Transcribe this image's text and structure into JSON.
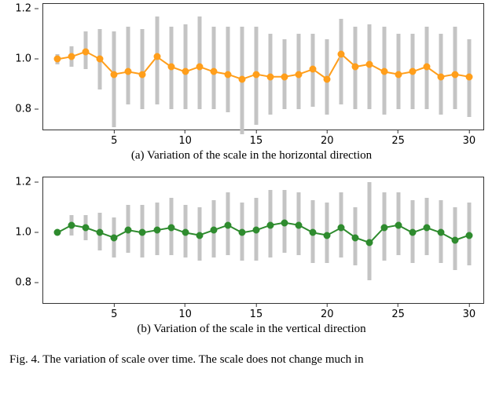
{
  "chart_data": [
    {
      "type": "line",
      "color": "#ff9e1b",
      "x": [
        1,
        2,
        3,
        4,
        5,
        6,
        7,
        8,
        9,
        10,
        11,
        12,
        13,
        14,
        15,
        16,
        17,
        18,
        19,
        20,
        21,
        22,
        23,
        24,
        25,
        26,
        27,
        28,
        29,
        30
      ],
      "values": [
        1.0,
        1.01,
        1.03,
        1.0,
        0.94,
        0.95,
        0.94,
        1.01,
        0.97,
        0.95,
        0.97,
        0.95,
        0.94,
        0.92,
        0.94,
        0.93,
        0.93,
        0.94,
        0.96,
        0.92,
        1.02,
        0.97,
        0.98,
        0.95,
        0.94,
        0.95,
        0.97,
        0.93,
        0.94,
        0.93
      ],
      "err_low": [
        0.98,
        0.97,
        0.96,
        0.88,
        0.73,
        0.82,
        0.8,
        0.82,
        0.8,
        0.8,
        0.8,
        0.8,
        0.79,
        0.7,
        0.74,
        0.78,
        0.8,
        0.8,
        0.81,
        0.78,
        0.82,
        0.8,
        0.8,
        0.78,
        0.8,
        0.8,
        0.8,
        0.78,
        0.8,
        0.77
      ],
      "err_high": [
        1.02,
        1.05,
        1.11,
        1.12,
        1.11,
        1.13,
        1.12,
        1.17,
        1.13,
        1.14,
        1.17,
        1.13,
        1.13,
        1.13,
        1.13,
        1.1,
        1.08,
        1.1,
        1.1,
        1.08,
        1.16,
        1.13,
        1.14,
        1.13,
        1.1,
        1.1,
        1.13,
        1.1,
        1.13,
        1.08
      ],
      "xlabel": "",
      "ylabel": "",
      "xlim": [
        0.0,
        31.0
      ],
      "ylim": [
        0.72,
        1.22
      ],
      "title": "",
      "x_ticks": [
        5,
        10,
        15,
        20,
        25,
        30
      ],
      "y_ticks": [
        0.8,
        1.0,
        1.2
      ]
    },
    {
      "type": "line",
      "color": "#2e8b2e",
      "x": [
        1,
        2,
        3,
        4,
        5,
        6,
        7,
        8,
        9,
        10,
        11,
        12,
        13,
        14,
        15,
        16,
        17,
        18,
        19,
        20,
        21,
        22,
        23,
        24,
        25,
        26,
        27,
        28,
        29,
        30
      ],
      "values": [
        1.0,
        1.03,
        1.02,
        1.0,
        0.98,
        1.01,
        1.0,
        1.01,
        1.02,
        1.0,
        0.99,
        1.01,
        1.03,
        1.0,
        1.01,
        1.03,
        1.04,
        1.03,
        1.0,
        0.99,
        1.02,
        0.98,
        0.96,
        1.02,
        1.03,
        1.0,
        1.02,
        1.0,
        0.97,
        0.99
      ],
      "err_low": [
        0.99,
        0.99,
        0.97,
        0.93,
        0.9,
        0.92,
        0.9,
        0.91,
        0.91,
        0.9,
        0.89,
        0.9,
        0.91,
        0.89,
        0.89,
        0.9,
        0.92,
        0.91,
        0.88,
        0.88,
        0.9,
        0.87,
        0.81,
        0.89,
        0.91,
        0.88,
        0.91,
        0.88,
        0.85,
        0.87
      ],
      "err_high": [
        1.01,
        1.07,
        1.07,
        1.08,
        1.06,
        1.11,
        1.11,
        1.12,
        1.14,
        1.11,
        1.1,
        1.13,
        1.16,
        1.12,
        1.14,
        1.17,
        1.17,
        1.16,
        1.13,
        1.12,
        1.16,
        1.1,
        1.2,
        1.16,
        1.16,
        1.13,
        1.14,
        1.13,
        1.1,
        1.12
      ],
      "xlabel": "",
      "ylabel": "",
      "xlim": [
        0.0,
        31.0
      ],
      "ylim": [
        0.72,
        1.22
      ],
      "title": "",
      "x_ticks": [
        5,
        10,
        15,
        20,
        25,
        30
      ],
      "y_ticks": [
        0.8,
        1.0,
        1.2
      ]
    }
  ],
  "captions": {
    "a": "(a) Variation of the scale in the horizontal direction",
    "b": "(b) Variation of the scale in the vertical direction"
  },
  "fig_caption": "Fig. 4.   The variation of scale over time. The scale does not change much in"
}
